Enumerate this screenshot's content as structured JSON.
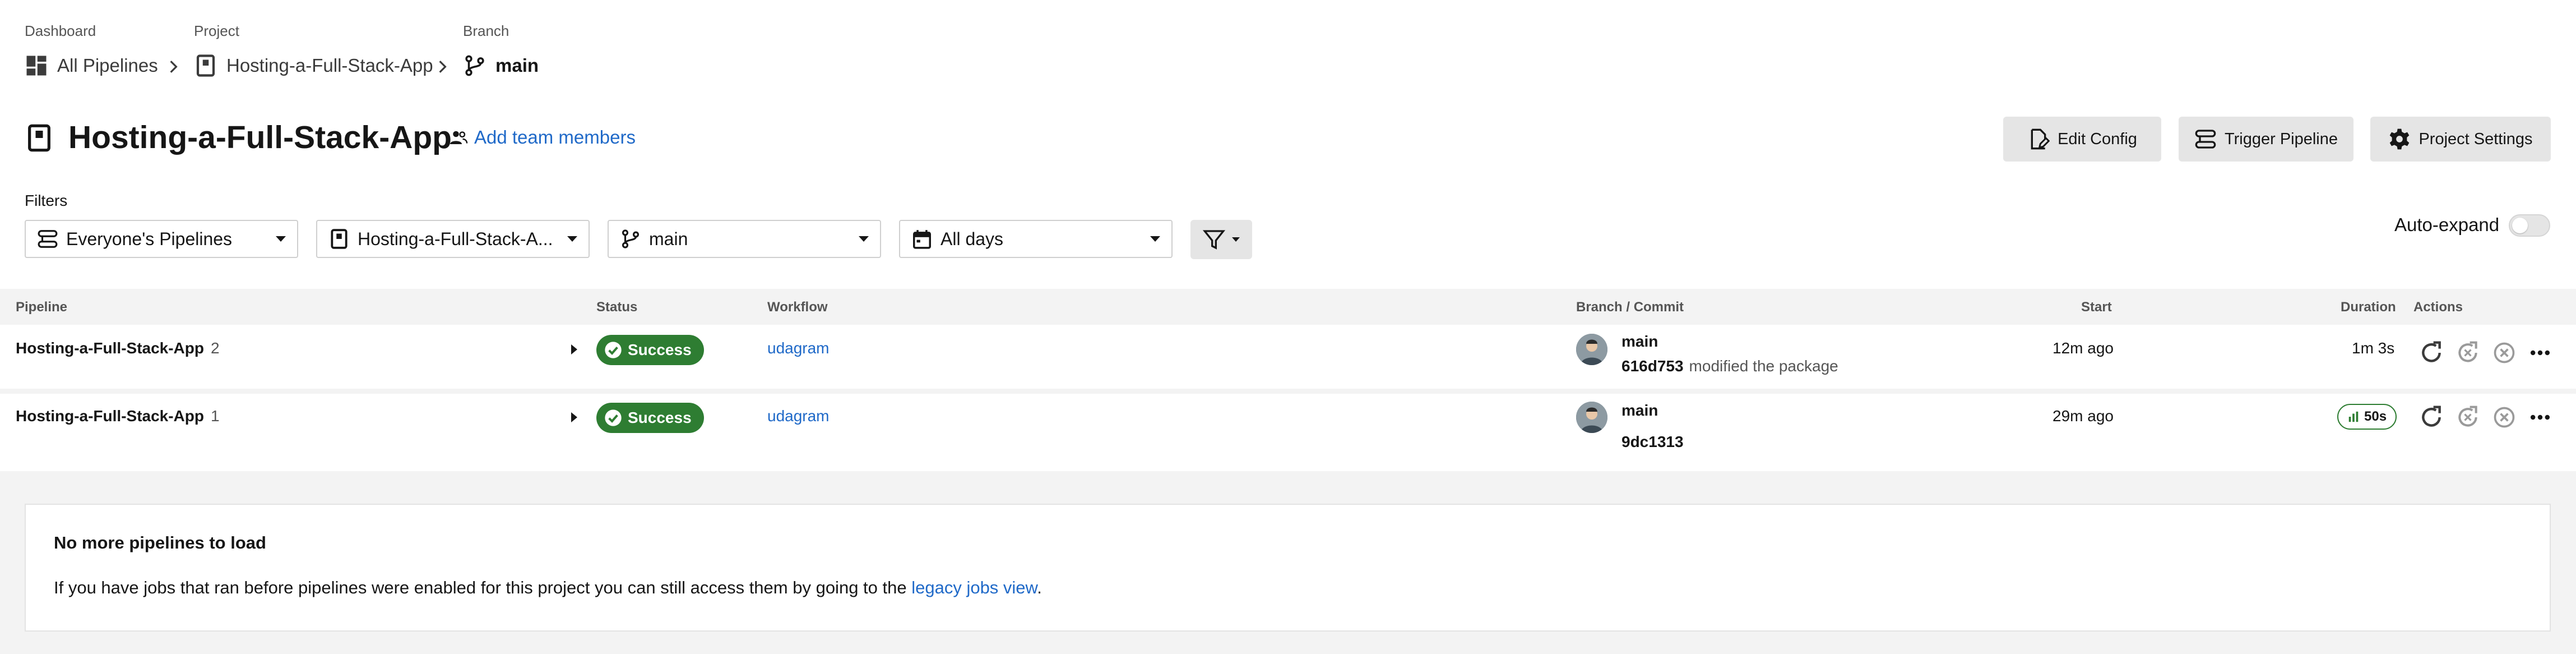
{
  "breadcrumb": {
    "dashboard": {
      "label": "Dashboard",
      "value": "All Pipelines"
    },
    "project": {
      "label": "Project",
      "value": "Hosting-a-Full-Stack-App"
    },
    "branch": {
      "label": "Branch",
      "value": "main"
    }
  },
  "header": {
    "title": "Hosting-a-Full-Stack-App",
    "add_team": "Add team members",
    "buttons": {
      "edit_config": "Edit Config",
      "trigger": "Trigger Pipeline",
      "settings": "Project Settings"
    }
  },
  "filters": {
    "label": "Filters",
    "pipelines": "Everyone's Pipelines",
    "project": "Hosting-a-Full-Stack-A...",
    "branch": "main",
    "days": "All days",
    "auto_expand": "Auto-expand",
    "auto_expand_on": false
  },
  "table": {
    "columns": {
      "pipeline": "Pipeline",
      "status": "Status",
      "workflow": "Workflow",
      "branch_commit": "Branch / Commit",
      "start": "Start",
      "duration": "Duration",
      "actions": "Actions"
    },
    "rows": [
      {
        "name": "Hosting-a-Full-Stack-App",
        "number": "2",
        "status": "Success",
        "workflow": "udagram",
        "branch": "main",
        "sha": "616d753",
        "message": "modified the package",
        "start": "12m ago",
        "duration": "1m 3s"
      },
      {
        "name": "Hosting-a-Full-Stack-App",
        "number": "1",
        "status": "Success",
        "workflow": "udagram",
        "branch": "main",
        "sha": "9dc1313",
        "message": "",
        "start": "29m ago",
        "duration": "50s"
      }
    ]
  },
  "empty": {
    "title": "No more pipelines to load",
    "text_before": "If you have jobs that ran before pipelines were enabled for this project you can still access them by going to the ",
    "link": "legacy jobs view",
    "text_after": "."
  },
  "colors": {
    "success": "#2e7d32",
    "link": "#1f69c8",
    "button_bg": "#e5e5e5"
  }
}
